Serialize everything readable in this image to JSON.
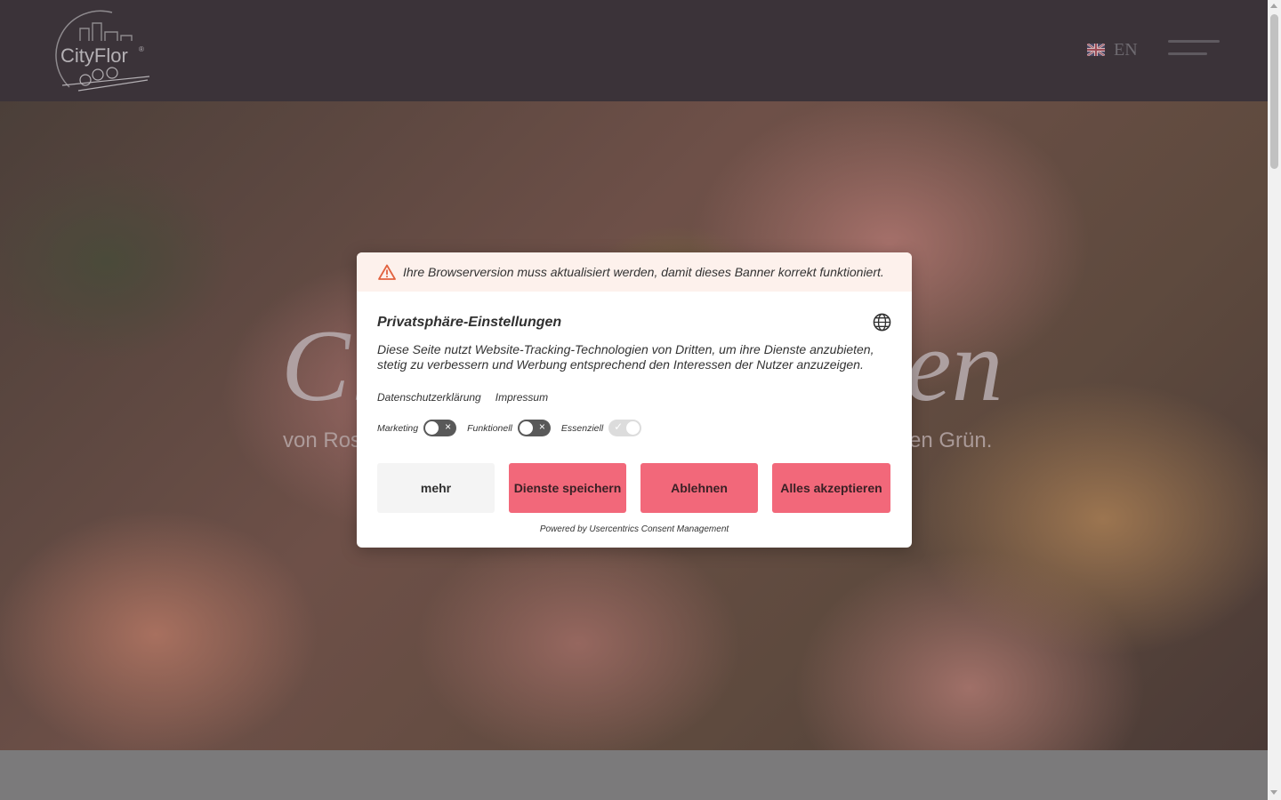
{
  "header": {
    "logo_text": "CityFlor",
    "language_label": "EN",
    "flag_icon": "uk-flag-icon",
    "menu_icon": "hamburger-menu-icon"
  },
  "hero": {
    "title_left": "Ci",
    "title_right": "en",
    "subtitle_left": "von Ros",
    "subtitle_right": "en Grün."
  },
  "consent": {
    "warning": "Ihre Browserversion muss aktualisiert werden, damit dieses Banner korrekt funktioniert.",
    "title": "Privatsphäre-Einstellungen",
    "description": "Diese Seite nutzt Website-Tracking-Technologien von Dritten, um ihre Dienste anzubieten, stetig zu verbessern und Werbung entsprechend den Interessen der Nutzer anzuzeigen.",
    "links": {
      "privacy": "Datenschutzerklärung",
      "imprint": "Impressum"
    },
    "toggles": {
      "marketing": "Marketing",
      "functional": "Funktionell",
      "essential": "Essenziell"
    },
    "buttons": {
      "more": "mehr",
      "save": "Dienste speichern",
      "decline": "Ablehnen",
      "accept_all": "Alles akzeptieren"
    },
    "powered_by": "Powered by Usercentrics Consent Management",
    "accent_color": "#f2687a"
  }
}
